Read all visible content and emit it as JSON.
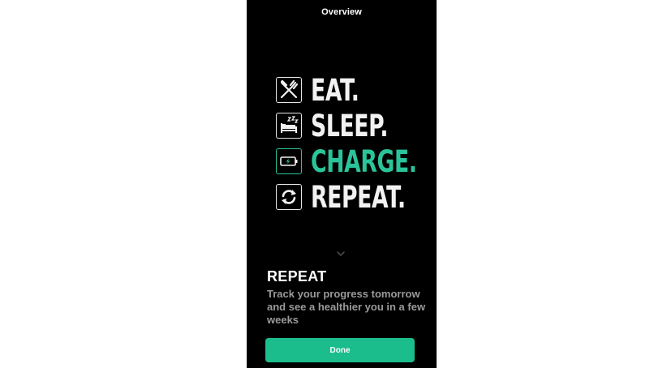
{
  "nav": {
    "title": "Overview"
  },
  "hero": {
    "items": [
      {
        "word": "EAT.",
        "icon": "fork-knife-icon"
      },
      {
        "word": "SLEEP.",
        "icon": "sleeping-bed-icon"
      },
      {
        "word": "CHARGE.",
        "icon": "battery-charging-icon"
      },
      {
        "word": "REPEAT.",
        "icon": "repeat-arrows-icon"
      }
    ],
    "accent_color": "#2ac49a",
    "text_color": "#f2f2f2"
  },
  "section": {
    "title": "REPEAT",
    "body": "Track your progress tomorrow and see a healthier you in a few weeks"
  },
  "actions": {
    "done_label": "Done",
    "button_color": "#1bbd8c"
  }
}
